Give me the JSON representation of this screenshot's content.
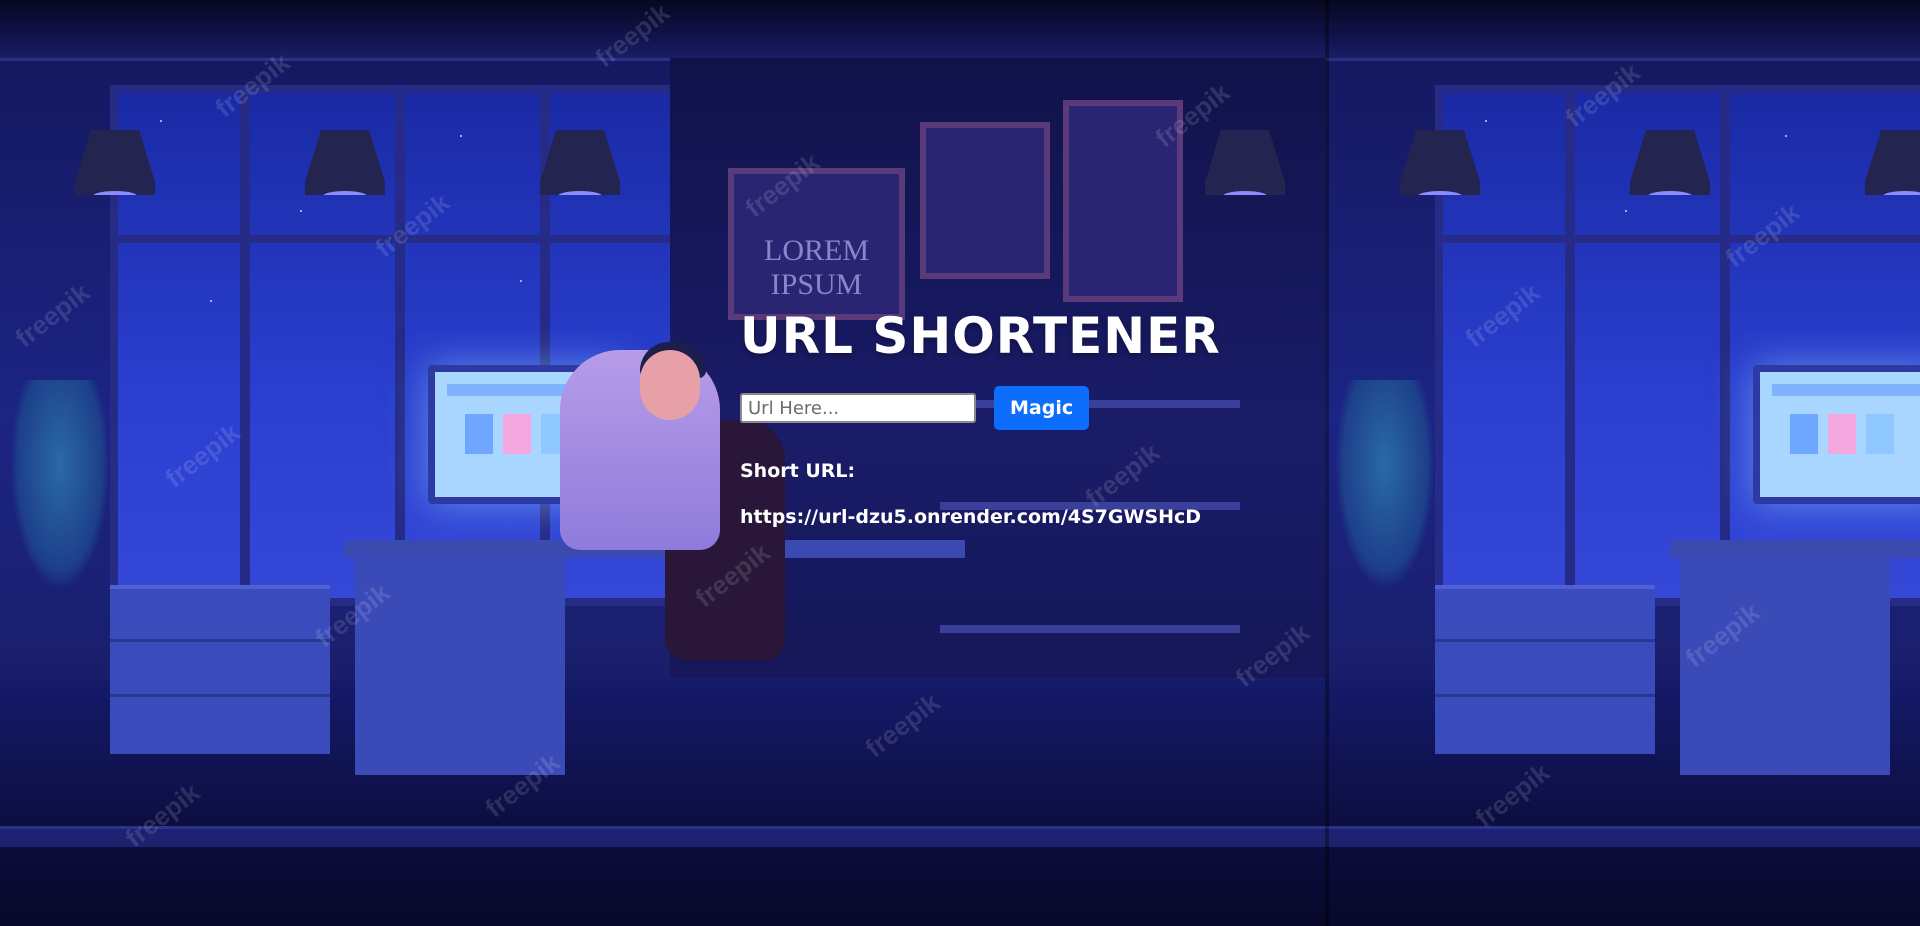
{
  "app": {
    "title": "URL SHORTENER",
    "input": {
      "placeholder": "Url Here...",
      "value": ""
    },
    "submit_label": "Magic",
    "result_label": "Short URL:",
    "result_value": "https://url-dzu5.onrender.com/4S7GWSHcD"
  },
  "background": {
    "frame_text": "LOREM IPSUM",
    "watermark_text": "freepik"
  },
  "colors": {
    "button": "#0d6efd",
    "background": "#1c2484",
    "text": "#ffffff"
  },
  "icons": [
    "freepik-watermark-icon"
  ]
}
